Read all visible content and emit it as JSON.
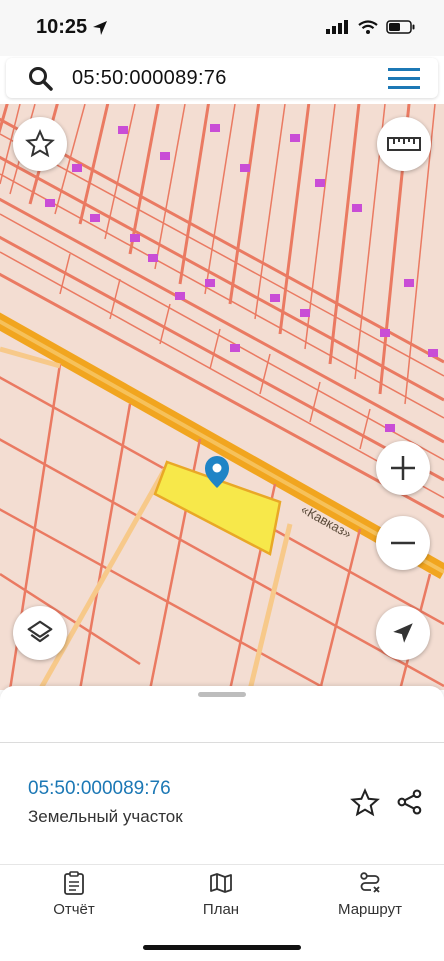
{
  "status_bar": {
    "time": "10:25",
    "icons": [
      "location-arrow-icon",
      "signal-icon",
      "wifi-icon",
      "battery-icon"
    ]
  },
  "search": {
    "value": "05:50:000089:76",
    "icons": [
      "search-icon",
      "menu-icon"
    ]
  },
  "map": {
    "road_label": "«Кавказ»",
    "colors": {
      "background": "#f3ddd2",
      "parcel_border": "#ea7a62",
      "road": "#f1a51f",
      "building": "#c94dd6",
      "selected_parcel": "#f7e84a"
    },
    "controls": [
      "favorite-star-icon",
      "ruler-icon",
      "zoom-in-icon",
      "zoom-out-icon",
      "layers-icon",
      "navigation-arrow-icon"
    ]
  },
  "sheet": {
    "cadastral_number": "05:50:000089:76",
    "type": "Земельный участок"
  },
  "tabbar": {
    "report": "Отчёт",
    "plan": "План",
    "route": "Маршрут"
  }
}
